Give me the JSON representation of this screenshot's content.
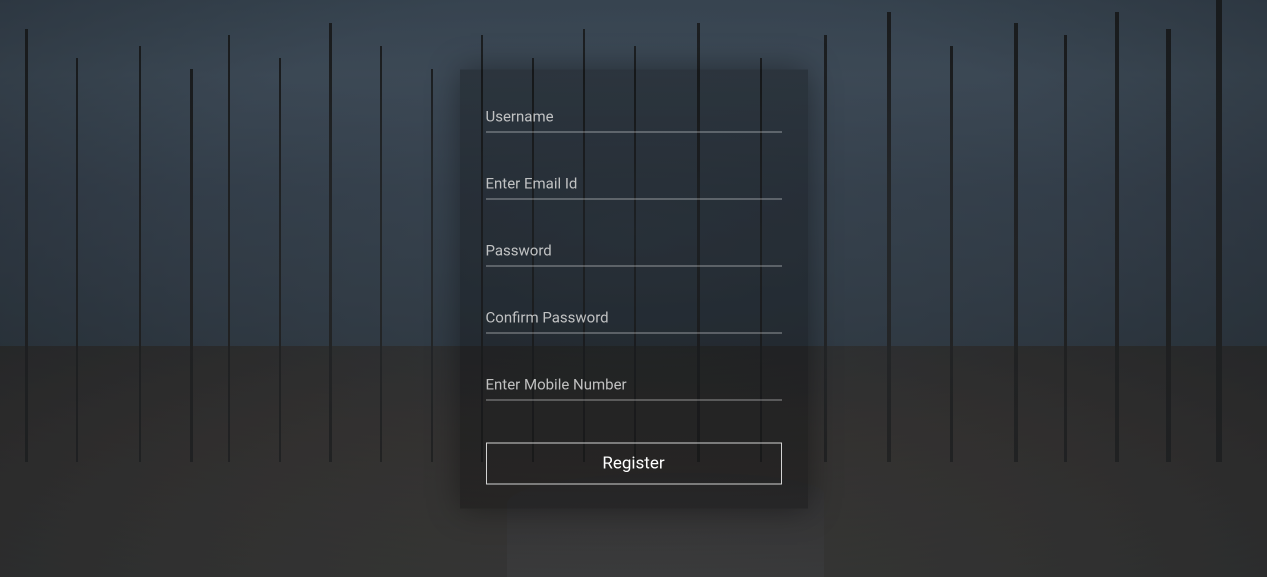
{
  "form": {
    "username": {
      "placeholder": "Username",
      "value": ""
    },
    "email": {
      "placeholder": "Enter Email Id",
      "value": ""
    },
    "password": {
      "placeholder": "Password",
      "value": ""
    },
    "confirmPassword": {
      "placeholder": "Confirm Password",
      "value": ""
    },
    "mobile": {
      "placeholder": "Enter Mobile Number",
      "value": ""
    },
    "registerButton": "Register"
  }
}
